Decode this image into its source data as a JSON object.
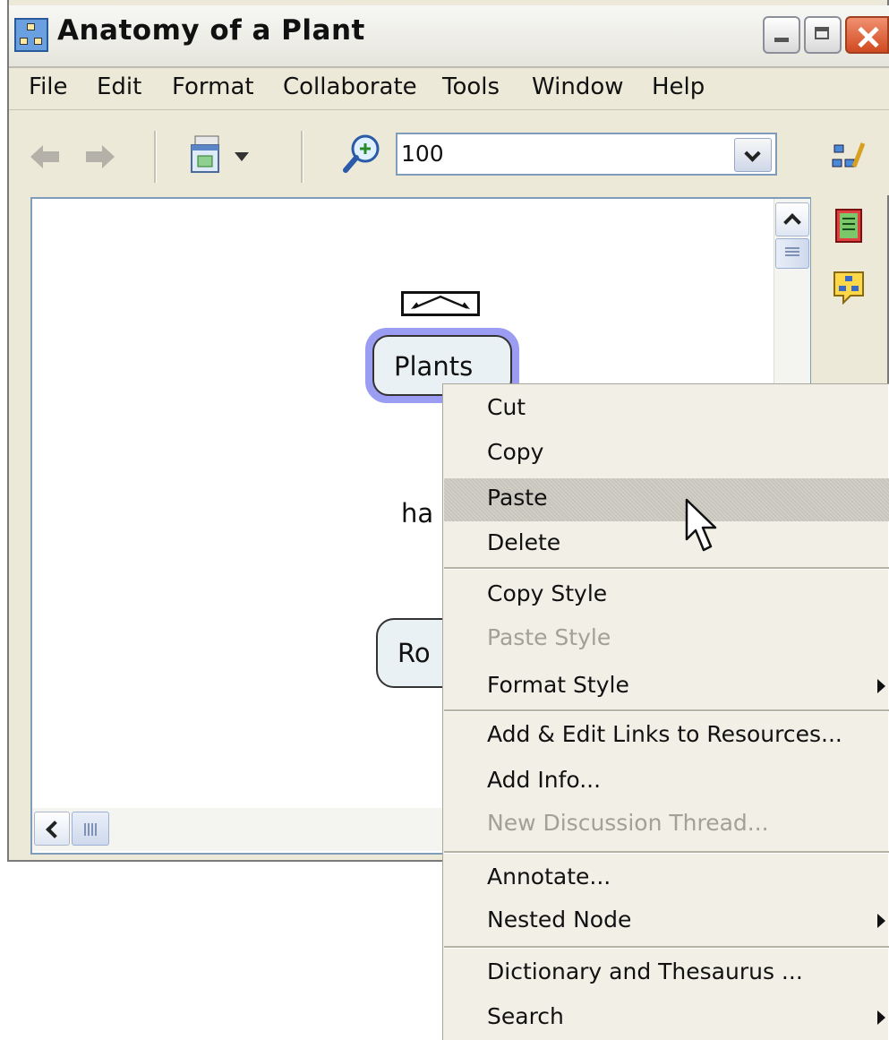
{
  "window": {
    "title": "Anatomy of a Plant"
  },
  "menubar": [
    "File",
    "Edit",
    "Format",
    "Collaborate",
    "Tools",
    "Window",
    "Help"
  ],
  "toolbar": {
    "zoom_value": "100"
  },
  "canvas": {
    "node_plants": "Plants",
    "link_phrase": "ha",
    "node_roots": "Ro"
  },
  "context_menu": {
    "cut": "Cut",
    "copy": "Copy",
    "paste": "Paste",
    "delete": "Delete",
    "copy_style": "Copy Style",
    "paste_style": "Paste Style",
    "format_style": "Format Style",
    "add_edit_links": "Add & Edit Links to Resources...",
    "add_info": "Add Info...",
    "new_discussion": "New Discussion Thread...",
    "annotate": "Annotate...",
    "nested_node": "Nested Node",
    "dictionary": "Dictionary and Thesaurus ...",
    "search": "Search"
  },
  "colors": {
    "node_selection": "#9a9df2",
    "node_fill": "#eaf1f4",
    "menu_highlight": "#c7c4bb"
  }
}
